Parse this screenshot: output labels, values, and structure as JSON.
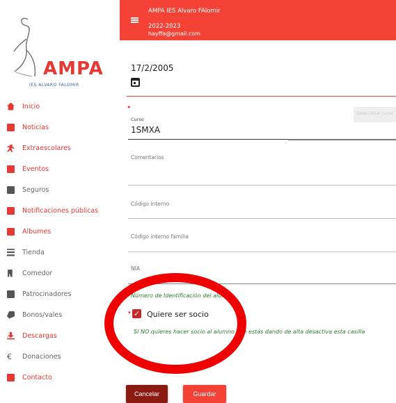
{
  "header": {
    "title": "AMPA IES Alvaro FAlomir",
    "year": "2022-2023",
    "email": "hayffa@gmail.com"
  },
  "logo": {
    "text": "AMPA",
    "subtitle": "IES ALVARO FALOMIR"
  },
  "sidebar": {
    "items": [
      {
        "label": "Inicio",
        "icon": "home-icon",
        "color": "#e53935"
      },
      {
        "label": "Noticias",
        "icon": "newspaper-icon",
        "color": "#e53935"
      },
      {
        "label": "Extraescolares",
        "icon": "running-icon",
        "color": "#e53935"
      },
      {
        "label": "Eventos",
        "icon": "calendar-icon",
        "color": "#e53935"
      },
      {
        "label": "Seguros",
        "icon": "shield-icon",
        "color": "#555555"
      },
      {
        "label": "Notificaciones públicas",
        "icon": "notification-icon",
        "color": "#e53935"
      },
      {
        "label": "Albumes",
        "icon": "album-icon",
        "color": "#e53935"
      },
      {
        "label": "Tienda",
        "icon": "store-icon",
        "color": "#555555"
      },
      {
        "label": "Comedor",
        "icon": "dining-icon",
        "color": "#555555"
      },
      {
        "label": "Patrocinadores",
        "icon": "sponsor-icon",
        "color": "#555555"
      },
      {
        "label": "Bonos/vales",
        "icon": "voucher-icon",
        "color": "#555555"
      },
      {
        "label": "Descargas",
        "icon": "download-icon",
        "color": "#e53935"
      },
      {
        "label": "Donaciones",
        "icon": "euro-icon",
        "color": "#555555"
      },
      {
        "label": "Contacto",
        "icon": "contact-icon",
        "color": "#e53935"
      }
    ]
  },
  "form": {
    "date_value": "17/2/2005",
    "required_mark": "•",
    "curso_label": "Curso",
    "curso_value": "1SMXA",
    "curso_side_button": "Seleccionar curso",
    "comentarios_label": "Comentarios",
    "codigo_interno_label": "Código interno",
    "codigo_familia_label": "Código interno familia",
    "nia_label": "NIA",
    "nia_help": "Número de Identificación del alumno",
    "socio_label": "Quiere ser socio",
    "socio_checked": true,
    "socio_help": "SI NO quieres hacer socio al alumno que estás dando de alta desactiva esta casilla"
  },
  "buttons": {
    "cancel": "Cancelar",
    "save": "Guardar"
  },
  "colors": {
    "primary": "#f44336",
    "dark_red": "#8b1a10",
    "help_green": "#2e7d32",
    "annotation": "#ee0000"
  }
}
